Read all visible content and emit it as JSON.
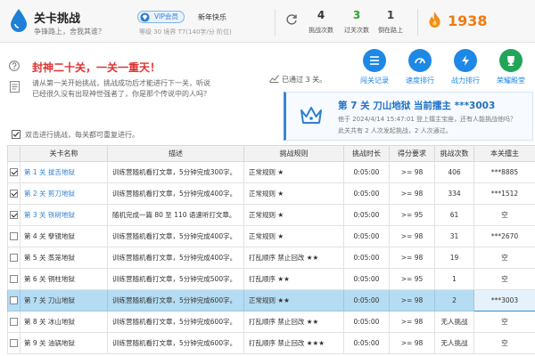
{
  "header": {
    "title": "关卡挑战",
    "subtitle": "争锋路上，舍我其谁？",
    "vip_label": "VIP会员",
    "greeting": "新年快乐",
    "user_meta": "等级 30 境界 T7(140字/分 阶位)",
    "stats": [
      {
        "value": "4",
        "label": "挑战次数",
        "color": "#222222"
      },
      {
        "value": "3",
        "label": "过关次数",
        "color": "#2aa32a"
      },
      {
        "value": "1",
        "label": "倒在路上",
        "color": "#444444"
      }
    ],
    "score": "1938"
  },
  "intro": {
    "motto": "封神二十关，一关一重天！",
    "line1": "请从第一关开始挑战，挑战成功后才能进行下一关，听说",
    "line2": "已经很久没有出现神世强者了，你是那个传说中的人吗？",
    "passed": "已通过 3 关。"
  },
  "quick_actions": [
    {
      "label": "闯关记录",
      "icon": "list-icon"
    },
    {
      "label": "速度排行",
      "icon": "speed-icon"
    },
    {
      "label": "战力排行",
      "icon": "power-icon"
    },
    {
      "label": "荣耀殿堂",
      "icon": "trophy-icon"
    }
  ],
  "champion": {
    "title": "第 7 关 刀山地狱 当前擂主 ***3003",
    "info": "他于 2024/4/14 15:47:01 登上擂主宝座，还有人能挑战他吗？",
    "share": "此关共有 2 人次发起挑战，2 人次通过。"
  },
  "hint": "双击进行挑战，每关都可重复进行。",
  "table": {
    "headers": [
      "关卡名称",
      "描述",
      "挑战规则",
      "挑战时长",
      "得分要求",
      "挑战次数",
      "本关擂主"
    ],
    "rows": [
      {
        "checked": true,
        "name": "第 1 关 拔舌地狱",
        "desc": "训练营随机看打文章，5分钟完成300字。",
        "rule": "正常规则 ★",
        "duration": "0:05:00",
        "score_req": ">= 98",
        "attempts": "406",
        "holder": "***8885",
        "passed": true
      },
      {
        "checked": true,
        "name": "第 2 关 剪刀地狱",
        "desc": "训练营随机看打文章，5分钟完成400字。",
        "rule": "正常规则 ★",
        "duration": "0:05:00",
        "score_req": ">= 98",
        "attempts": "334",
        "holder": "***1512",
        "passed": true
      },
      {
        "checked": true,
        "name": "第 3 关 铁树地狱",
        "desc": "随机完成一篇 80 至 110 语速听打文章。",
        "rule": "正常规则 ★",
        "duration": "0:05:00",
        "score_req": ">= 95",
        "attempts": "61",
        "holder": "空",
        "passed": true
      },
      {
        "checked": false,
        "name": "第 4 关 孽镜地狱",
        "desc": "训练营随机看打文章，5分钟完成400字。",
        "rule": "正常规则 ★",
        "duration": "0:05:00",
        "score_req": ">= 98",
        "attempts": "31",
        "holder": "***2670",
        "passed": false
      },
      {
        "checked": false,
        "name": "第 5 关 蒸笼地狱",
        "desc": "训练营随机看打文章，5分钟完成400字。",
        "rule": "打乱顺序 禁止回改 ★★",
        "duration": "0:05:00",
        "score_req": ">= 98",
        "attempts": "19",
        "holder": "空",
        "passed": false
      },
      {
        "checked": false,
        "name": "第 6 关 铜柱地狱",
        "desc": "训练营随机看打文章，5分钟完成500字。",
        "rule": "打乱顺序 ★★",
        "duration": "0:05:00",
        "score_req": ">= 95",
        "attempts": "1",
        "holder": "空",
        "passed": false
      },
      {
        "checked": false,
        "name": "第 7 关 刀山地狱",
        "desc": "训练营随机看打文章，5分钟完成600字。",
        "rule": "正常规则 ★★",
        "duration": "0:05:00",
        "score_req": ">= 98",
        "attempts": "2",
        "holder": "***3003",
        "passed": false,
        "selected": true
      },
      {
        "checked": false,
        "name": "第 8 关 冰山地狱",
        "desc": "训练营随机看打文章，5分钟完成600字。",
        "rule": "打乱顺序 禁止回改 ★★",
        "duration": "0:05:00",
        "score_req": ">= 98",
        "attempts": "无人挑战",
        "holder": "空",
        "passed": false
      },
      {
        "checked": false,
        "name": "第 9 关 油锅地狱",
        "desc": "训练营随机看打文章，5分钟完成600字。",
        "rule": "打乱顺序 禁止回改 ★★★",
        "duration": "0:05:00",
        "score_req": ">= 98",
        "attempts": "无人挑战",
        "holder": "空",
        "passed": false
      }
    ]
  }
}
